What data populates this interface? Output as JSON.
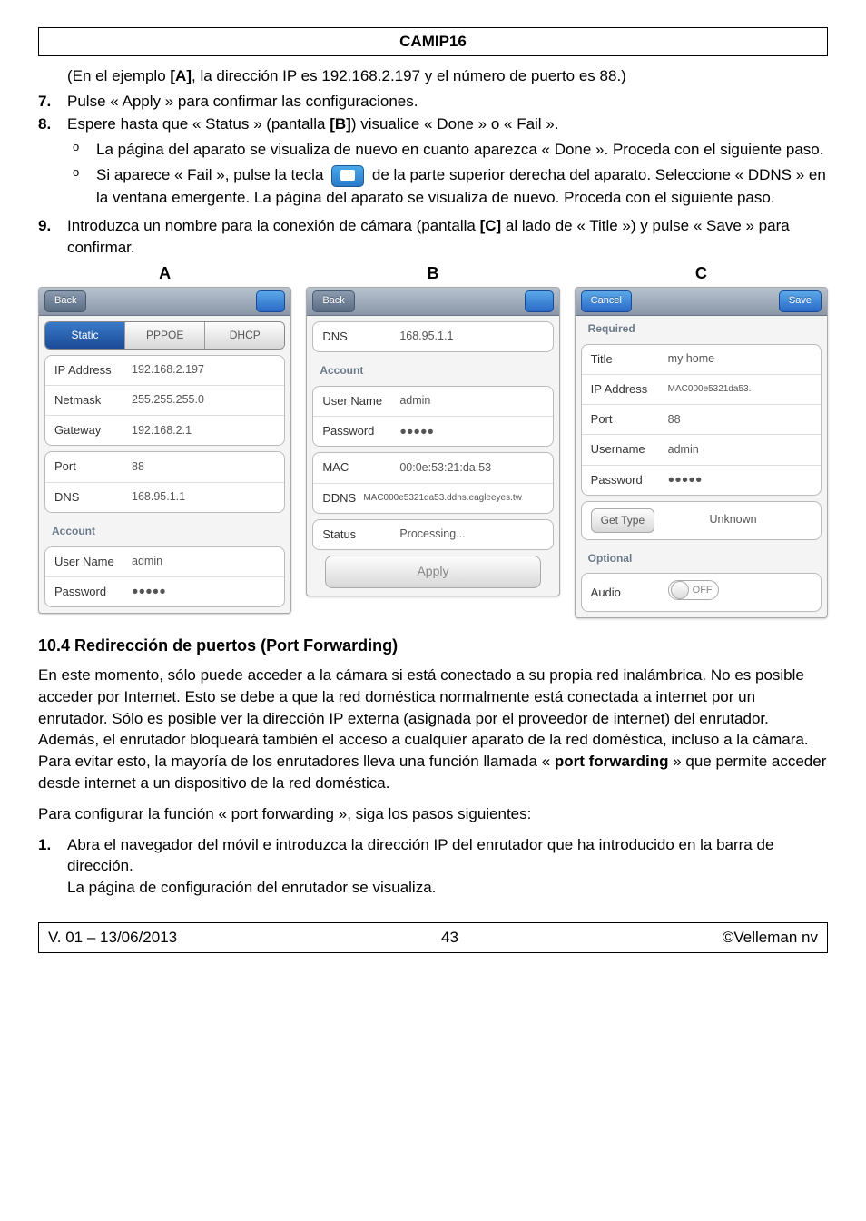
{
  "header": {
    "title": "CAMIP16"
  },
  "intro": {
    "example_text_pre": "(En el ejemplo ",
    "example_ref": "[A]",
    "example_text_post": ", la dirección IP es 192.168.2.197 y el número de puerto es 88.)"
  },
  "steps": {
    "s7": {
      "num": "7.",
      "text": "Pulse « Apply » para confirmar las configuraciones."
    },
    "s8": {
      "num": "8.",
      "text_pre": "Espere hasta que « Status » (pantalla ",
      "ref": "[B]",
      "text_post": ") visualice « Done » o « Fail ».",
      "bullets": {
        "b1": "La página del aparato se visualiza de nuevo en cuanto aparezca « Done ». Proceda con el siguiente paso.",
        "b2_pre": "Si aparece « Fail », pulse la tecla ",
        "b2_post": " de la parte superior derecha del aparato. Seleccione « DDNS » en la ventana emergente. La página del aparato se visualiza de nuevo. Proceda con el siguiente paso."
      }
    },
    "s9": {
      "num": "9.",
      "text_pre": "Introduzca un nombre para la conexión de cámara (pantalla ",
      "ref": "[C]",
      "text_post": " al lado de « Title ») y pulse « Save » para confirmar."
    }
  },
  "figures": {
    "a": {
      "label": "A",
      "back": "Back",
      "tabs": {
        "static": "Static",
        "pppoe": "PPPOE",
        "dhcp": "DHCP"
      },
      "rows": {
        "ip_label": "IP Address",
        "ip": "192.168.2.197",
        "netmask_label": "Netmask",
        "netmask": "255.255.255.0",
        "gateway_label": "Gateway",
        "gateway": "192.168.2.1",
        "port_label": "Port",
        "port": "88",
        "dns_label": "DNS",
        "dns": "168.95.1.1"
      },
      "account_label": "Account",
      "account": {
        "username_label": "User Name",
        "username": "admin",
        "password_label": "Password",
        "password": "●●●●●"
      }
    },
    "b": {
      "label": "B",
      "back": "Back",
      "rows": {
        "dns_label": "DNS",
        "dns": "168.95.1.1"
      },
      "account_label": "Account",
      "account": {
        "username_label": "User Name",
        "username": "admin",
        "password_label": "Password",
        "password": "●●●●●"
      },
      "mac_label": "MAC",
      "mac": "00:0e:53:21:da:53",
      "ddns_label": "DDNS",
      "ddns": "MAC000e5321da53.ddns.eagleeyes.tw",
      "status_label": "Status",
      "status": "Processing...",
      "apply": "Apply"
    },
    "c": {
      "label": "C",
      "cancel": "Cancel",
      "save": "Save",
      "required_label": "Required",
      "rows": {
        "title_label": "Title",
        "title": "my home",
        "ip_label": "IP Address",
        "ip": "MAC000e5321da53.",
        "port_label": "Port",
        "port": "88",
        "username_label": "Username",
        "username": "admin",
        "password_label": "Password",
        "password": "●●●●●"
      },
      "gettype_label": "Get Type",
      "gettype": "Unknown",
      "optional_label": "Optional",
      "audio_label": "Audio",
      "audio_toggle": "OFF"
    }
  },
  "section": {
    "heading": "10.4   Redirección de puertos (Port Forwarding)",
    "para1_pre": "En este momento, sólo puede acceder a la cámara si está conectado a su propia red inalámbrica. No es posible acceder por Internet. Esto se debe a que la red doméstica normalmente está conectada a internet por un enrutador. Sólo es posible ver la dirección IP externa (asignada por el proveedor de internet) del enrutador. Además, el enrutador bloqueará también el acceso a cualquier aparato de la red doméstica, incluso a la cámara. Para evitar esto, la mayoría de los enrutadores lleva una función llamada « ",
    "para1_bold": "port forwarding",
    "para1_post": " » que permite acceder desde internet a un dispositivo de la red doméstica.",
    "para2": "Para configurar la función « port forwarding », siga los pasos siguientes:",
    "pf1": {
      "num": "1.",
      "line1": "Abra el navegador del móvil e introduzca la dirección IP del enrutador que ha introducido en la barra de dirección.",
      "line2": "La página de configuración del enrutador se visualiza."
    }
  },
  "footer": {
    "left": "V. 01 – 13/06/2013",
    "center": "43",
    "right": "©Velleman nv"
  }
}
